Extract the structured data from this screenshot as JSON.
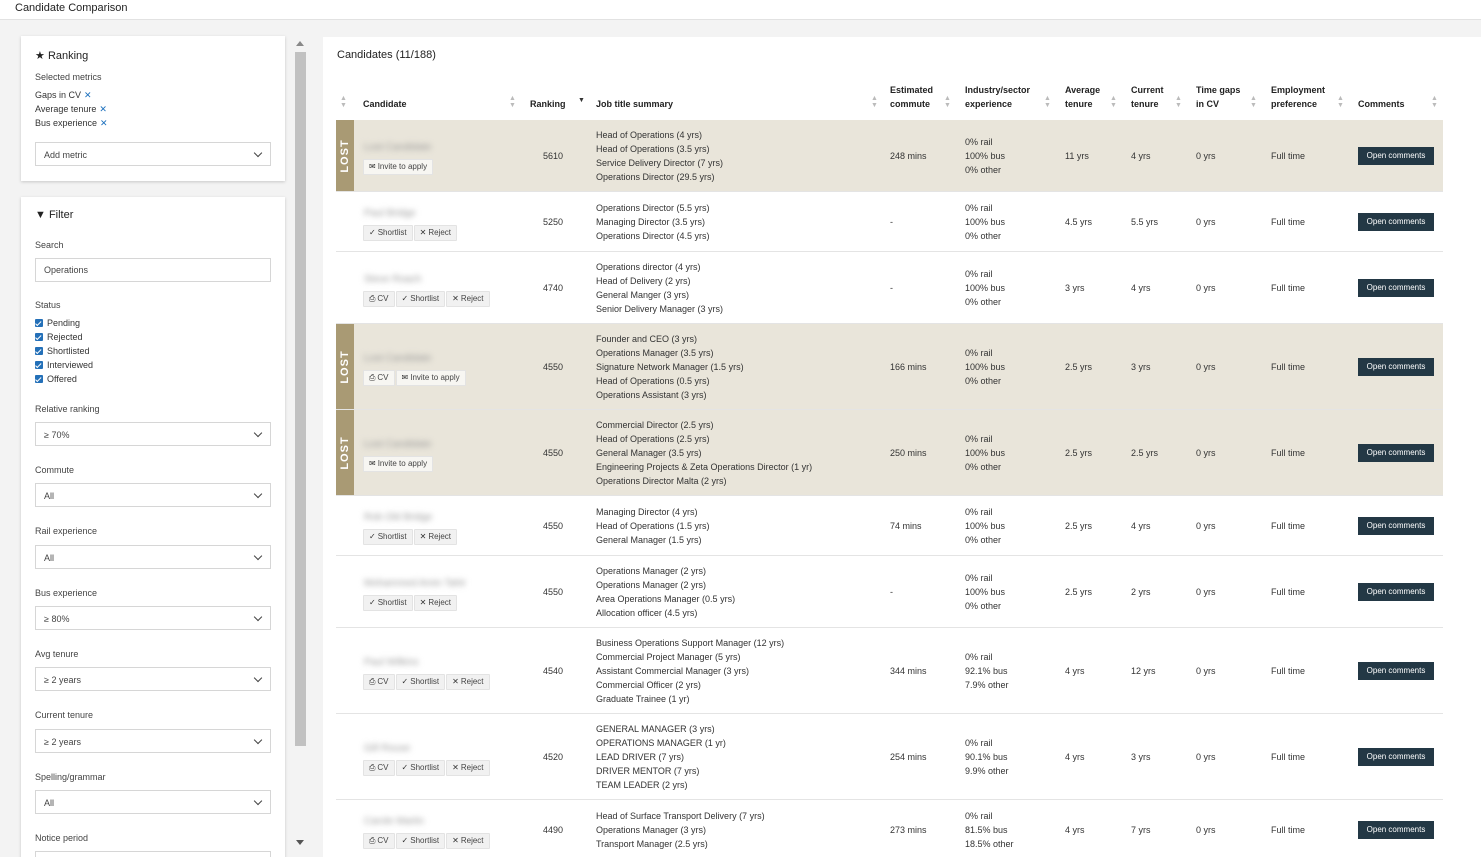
{
  "app": {
    "title": "Candidate Comparison"
  },
  "ranking": {
    "title": "Ranking",
    "selected_label": "Selected metrics",
    "metrics": [
      "Gaps in CV",
      "Average tenure",
      "Bus experience"
    ],
    "add_placeholder": "Add metric"
  },
  "filter": {
    "title": "Filter",
    "search_label": "Search",
    "search_value": "Operations",
    "status_label": "Status",
    "statuses": [
      "Pending",
      "Rejected",
      "Shortlisted",
      "Interviewed",
      "Offered"
    ],
    "relative_ranking": {
      "label": "Relative ranking",
      "value": "≥ 70%"
    },
    "commute": {
      "label": "Commute",
      "value": "All"
    },
    "rail": {
      "label": "Rail experience",
      "value": "All"
    },
    "bus": {
      "label": "Bus experience",
      "value": "≥ 80%"
    },
    "avg_tenure": {
      "label": "Avg tenure",
      "value": "≥ 2 years"
    },
    "current_tenure": {
      "label": "Current tenure",
      "value": "≥ 2 years"
    },
    "spelling": {
      "label": "Spelling/grammar",
      "value": "All"
    },
    "notice": {
      "label": "Notice period"
    }
  },
  "candidates": {
    "heading": "Candidates (11/188)",
    "columns": {
      "candidate": "Candidate",
      "ranking": "Ranking",
      "job": "Job title summary",
      "commute_1": "Estimated",
      "commute_2": "commute",
      "industry_1": "Industry/sector",
      "industry_2": "experience",
      "avg_1": "Average",
      "avg_2": "tenure",
      "cur_1": "Current",
      "cur_2": "tenure",
      "gaps_1": "Time gaps",
      "gaps_2": "in CV",
      "emp_1": "Employment",
      "emp_2": "preference",
      "comments": "Comments"
    },
    "lost_label": "LOST",
    "action_labels": {
      "invite": "Invite to apply",
      "cv": "CV",
      "shortlist": "Shortlist",
      "reject": "Reject"
    },
    "comment_label": "Open comments",
    "rows": [
      {
        "lost": true,
        "name": "Lost Candidate",
        "actions": [
          "invite"
        ],
        "ranking": "5610",
        "jobs": [
          "Head of Operations (4 yrs)",
          "Head of Operations (3.5 yrs)",
          "Service Delivery Director (7 yrs)",
          "Operations Director (29.5 yrs)"
        ],
        "commute": "248 mins",
        "industry": [
          "0% rail",
          "100% bus",
          "0% other"
        ],
        "avg": "11 yrs",
        "current": "4 yrs",
        "gaps": "0 yrs",
        "emp": "Full time"
      },
      {
        "lost": false,
        "name": "Paul Bridge",
        "actions": [
          "shortlist",
          "reject"
        ],
        "ranking": "5250",
        "jobs": [
          "Operations Director (5.5 yrs)",
          "Managing Director (3.5 yrs)",
          "Operations Director (4.5 yrs)"
        ],
        "commute": "-",
        "industry": [
          "0% rail",
          "100% bus",
          "0% other"
        ],
        "avg": "4.5 yrs",
        "current": "5.5 yrs",
        "gaps": "0 yrs",
        "emp": "Full time"
      },
      {
        "lost": false,
        "name": "Steve Roach",
        "actions": [
          "cv",
          "shortlist",
          "reject"
        ],
        "ranking": "4740",
        "jobs": [
          "Operations director (4 yrs)",
          "Head of Delivery (2 yrs)",
          "General Manger (3 yrs)",
          "Senior Delivery Manager (3 yrs)"
        ],
        "commute": "-",
        "industry": [
          "0% rail",
          "100% bus",
          "0% other"
        ],
        "avg": "3 yrs",
        "current": "4 yrs",
        "gaps": "0 yrs",
        "emp": "Full time"
      },
      {
        "lost": true,
        "name": "Lost Candidate",
        "actions": [
          "cv",
          "invite"
        ],
        "ranking": "4550",
        "jobs": [
          "Founder and CEO (3 yrs)",
          "Operations Manager (3.5 yrs)",
          "Signature Network Manager (1.5 yrs)",
          "Head of Operations (0.5 yrs)",
          "Operations Assistant (3 yrs)"
        ],
        "commute": "166 mins",
        "industry": [
          "0% rail",
          "100% bus",
          "0% other"
        ],
        "avg": "2.5 yrs",
        "current": "3 yrs",
        "gaps": "0 yrs",
        "emp": "Full time"
      },
      {
        "lost": true,
        "name": "Lost Candidate",
        "actions": [
          "invite"
        ],
        "ranking": "4550",
        "jobs": [
          "Commercial Director (2.5 yrs)",
          "Head of Operations (2.5 yrs)",
          "General Manager (3.5 yrs)",
          "Engineering Projects & Zeta Operations Director (1 yr)",
          "Operations Director Malta (2 yrs)"
        ],
        "commute": "250 mins",
        "industry": [
          "0% rail",
          "100% bus",
          "0% other"
        ],
        "avg": "2.5 yrs",
        "current": "2.5 yrs",
        "gaps": "0 yrs",
        "emp": "Full time"
      },
      {
        "lost": false,
        "name": "Rob Old Bridge",
        "actions": [
          "shortlist",
          "reject"
        ],
        "ranking": "4550",
        "jobs": [
          "Managing Director (4 yrs)",
          "Head of Operations (1.5 yrs)",
          "General Manager (1.5 yrs)"
        ],
        "commute": "74 mins",
        "industry": [
          "0% rail",
          "100% bus",
          "0% other"
        ],
        "avg": "2.5 yrs",
        "current": "4 yrs",
        "gaps": "0 yrs",
        "emp": "Full time"
      },
      {
        "lost": false,
        "name": "Mohammed Amin Tahir",
        "actions": [
          "shortlist",
          "reject"
        ],
        "ranking": "4550",
        "jobs": [
          "Operations Manager (2 yrs)",
          "Operations Manager (2 yrs)",
          "Area Operations Manager (0.5 yrs)",
          "Allocation officer (4.5 yrs)"
        ],
        "commute": "-",
        "industry": [
          "0% rail",
          "100% bus",
          "0% other"
        ],
        "avg": "2.5 yrs",
        "current": "2 yrs",
        "gaps": "0 yrs",
        "emp": "Full time"
      },
      {
        "lost": false,
        "name": "Paul Wilkins",
        "actions": [
          "cv",
          "shortlist",
          "reject"
        ],
        "ranking": "4540",
        "jobs": [
          "Business Operations Support Manager (12 yrs)",
          "Commercial Project Manager (5 yrs)",
          "Assistant Commercial Manager (3 yrs)",
          "Commercial Officer (2 yrs)",
          "Graduate Trainee (1 yr)"
        ],
        "commute": "344 mins",
        "industry": [
          "0% rail",
          "92.1% bus",
          "7.9% other"
        ],
        "avg": "4 yrs",
        "current": "12 yrs",
        "gaps": "0 yrs",
        "emp": "Full time"
      },
      {
        "lost": false,
        "name": "Gill Rouse",
        "actions": [
          "cv",
          "shortlist",
          "reject"
        ],
        "ranking": "4520",
        "jobs": [
          "GENERAL MANAGER (3 yrs)",
          "OPERATIONS MANAGER (1 yr)",
          "LEAD DRIVER (7 yrs)",
          "DRIVER MENTOR (7 yrs)",
          "TEAM LEADER (2 yrs)"
        ],
        "commute": "254 mins",
        "industry": [
          "0% rail",
          "90.1% bus",
          "9.9% other"
        ],
        "avg": "4 yrs",
        "current": "3 yrs",
        "gaps": "0 yrs",
        "emp": "Full time"
      },
      {
        "lost": false,
        "name": "Carole Martin",
        "actions": [
          "cv",
          "shortlist",
          "reject"
        ],
        "ranking": "4490",
        "jobs": [
          "Head of Surface Transport Delivery (7 yrs)",
          "Operations Manager (3 yrs)",
          "Transport Manager (2.5 yrs)"
        ],
        "commute": "273 mins",
        "industry": [
          "0% rail",
          "81.5% bus",
          "18.5% other"
        ],
        "avg": "4 yrs",
        "current": "7 yrs",
        "gaps": "0 yrs",
        "emp": "Full time"
      }
    ]
  }
}
